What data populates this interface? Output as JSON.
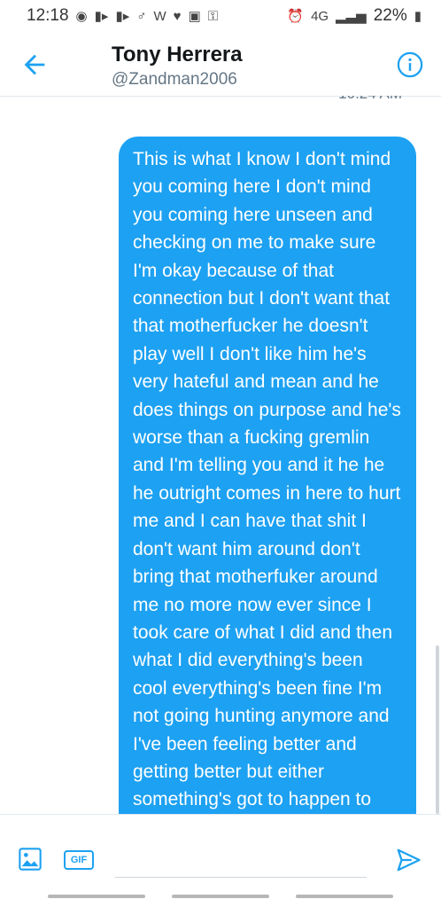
{
  "status_bar": {
    "time": "12:18",
    "left_icons": [
      "ghost-icon",
      "video-icon",
      "video-icon",
      "male-icon",
      "w-icon",
      "heart-icon",
      "shield-icon",
      "lock-icon"
    ],
    "network": "4G",
    "battery": "22%"
  },
  "header": {
    "name": "Tony Herrera",
    "handle": "@Zandman2006"
  },
  "conversation": {
    "timestamp_partial": "10:24 AM",
    "message_text": "This is what I know I don't mind you coming here I don't mind you coming here unseen and checking on me to make sure I'm okay because of that connection but I don't want that that motherfucker he doesn't play well I don't like him he's very hateful and mean and he does things on purpose and he's worse than a fucking gremlin and I'm telling you and it he he he outright comes in here to hurt me and I can have that shit I don't want him around don't bring that motherfuker around me no more now ever since I took care of what I did and then what I did everything's been cool everything's been fine I'm not going hunting anymore and I've been feeling better and getting better but either something's got to happen to him like not come near me at"
  },
  "composer": {
    "gif_label": "GIF",
    "input_value": "",
    "input_placeholder": ""
  },
  "colors": {
    "accent": "#1da1f2",
    "bubble_text": "#ffffff",
    "secondary_text": "#657786"
  }
}
